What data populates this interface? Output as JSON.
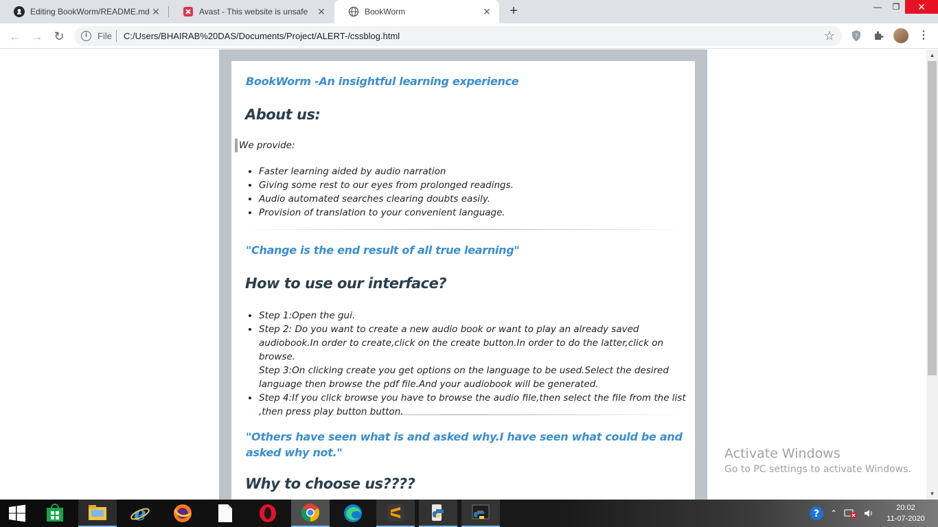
{
  "browser": {
    "tabs": [
      {
        "title": "Editing BookWorm/README.md",
        "icon": "github-icon",
        "active": false
      },
      {
        "title": "Avast - This website is unsafe",
        "icon": "avast-icon",
        "active": false
      },
      {
        "title": "BookWorm",
        "icon": "globe-icon",
        "active": true
      }
    ],
    "address": {
      "scheme_label": "File",
      "url": "C:/Users/BHAIRAB%20DAS/Documents/Project/ALERT-/cssblog.html"
    }
  },
  "page": {
    "heading": "BookWorm -An insightful learning experience",
    "about_title": "About us:",
    "provide_label": "We provide:",
    "provide_items": [
      "Faster learning aided by audio narration",
      "Giving some rest to our eyes from prolonged readings.",
      "Audio automated searches clearing doubts easily.",
      "Provision of translation to your convenient language."
    ],
    "quote1": "\"Change is the end result of all true learning\"",
    "howto_title": "How to use our interface?",
    "steps": [
      "Step 1:Open the gui.",
      "Step 2: Do you want to create a new audio book or want to play an already saved audiobook.In order to create,click on the create button.In order to do the latter,click on browse.",
      "Step 3:On clicking create you get options on the language to be used.Select the desired language then browse the pdf file.And your audiobook will be generated.",
      "Step 4:If you click browse you have to browse the audio file,then select the file from the list ,then press play button button."
    ],
    "quote2": "\"Others have seen what is and asked why.I have seen what could be and asked why not.\"",
    "why_title": "Why to choose us????"
  },
  "watermark": {
    "line1": "Activate Windows",
    "line2": "Go to PC settings to activate Windows."
  },
  "taskbar": {
    "time": "20:02",
    "date": "11-07-2020",
    "apps": [
      "start-icon",
      "store-icon",
      "file-explorer-icon",
      "internet-explorer-icon",
      "firefox-icon",
      "notepad-icon",
      "opera-icon",
      "chrome-icon",
      "edge-icon",
      "sublime-icon",
      "python-idle-icon",
      "python-terminal-icon"
    ]
  },
  "colors": {
    "accent_heading": "#3a8fd0",
    "title_dark": "#2c3e50",
    "page_background": "#bdc3c7"
  }
}
